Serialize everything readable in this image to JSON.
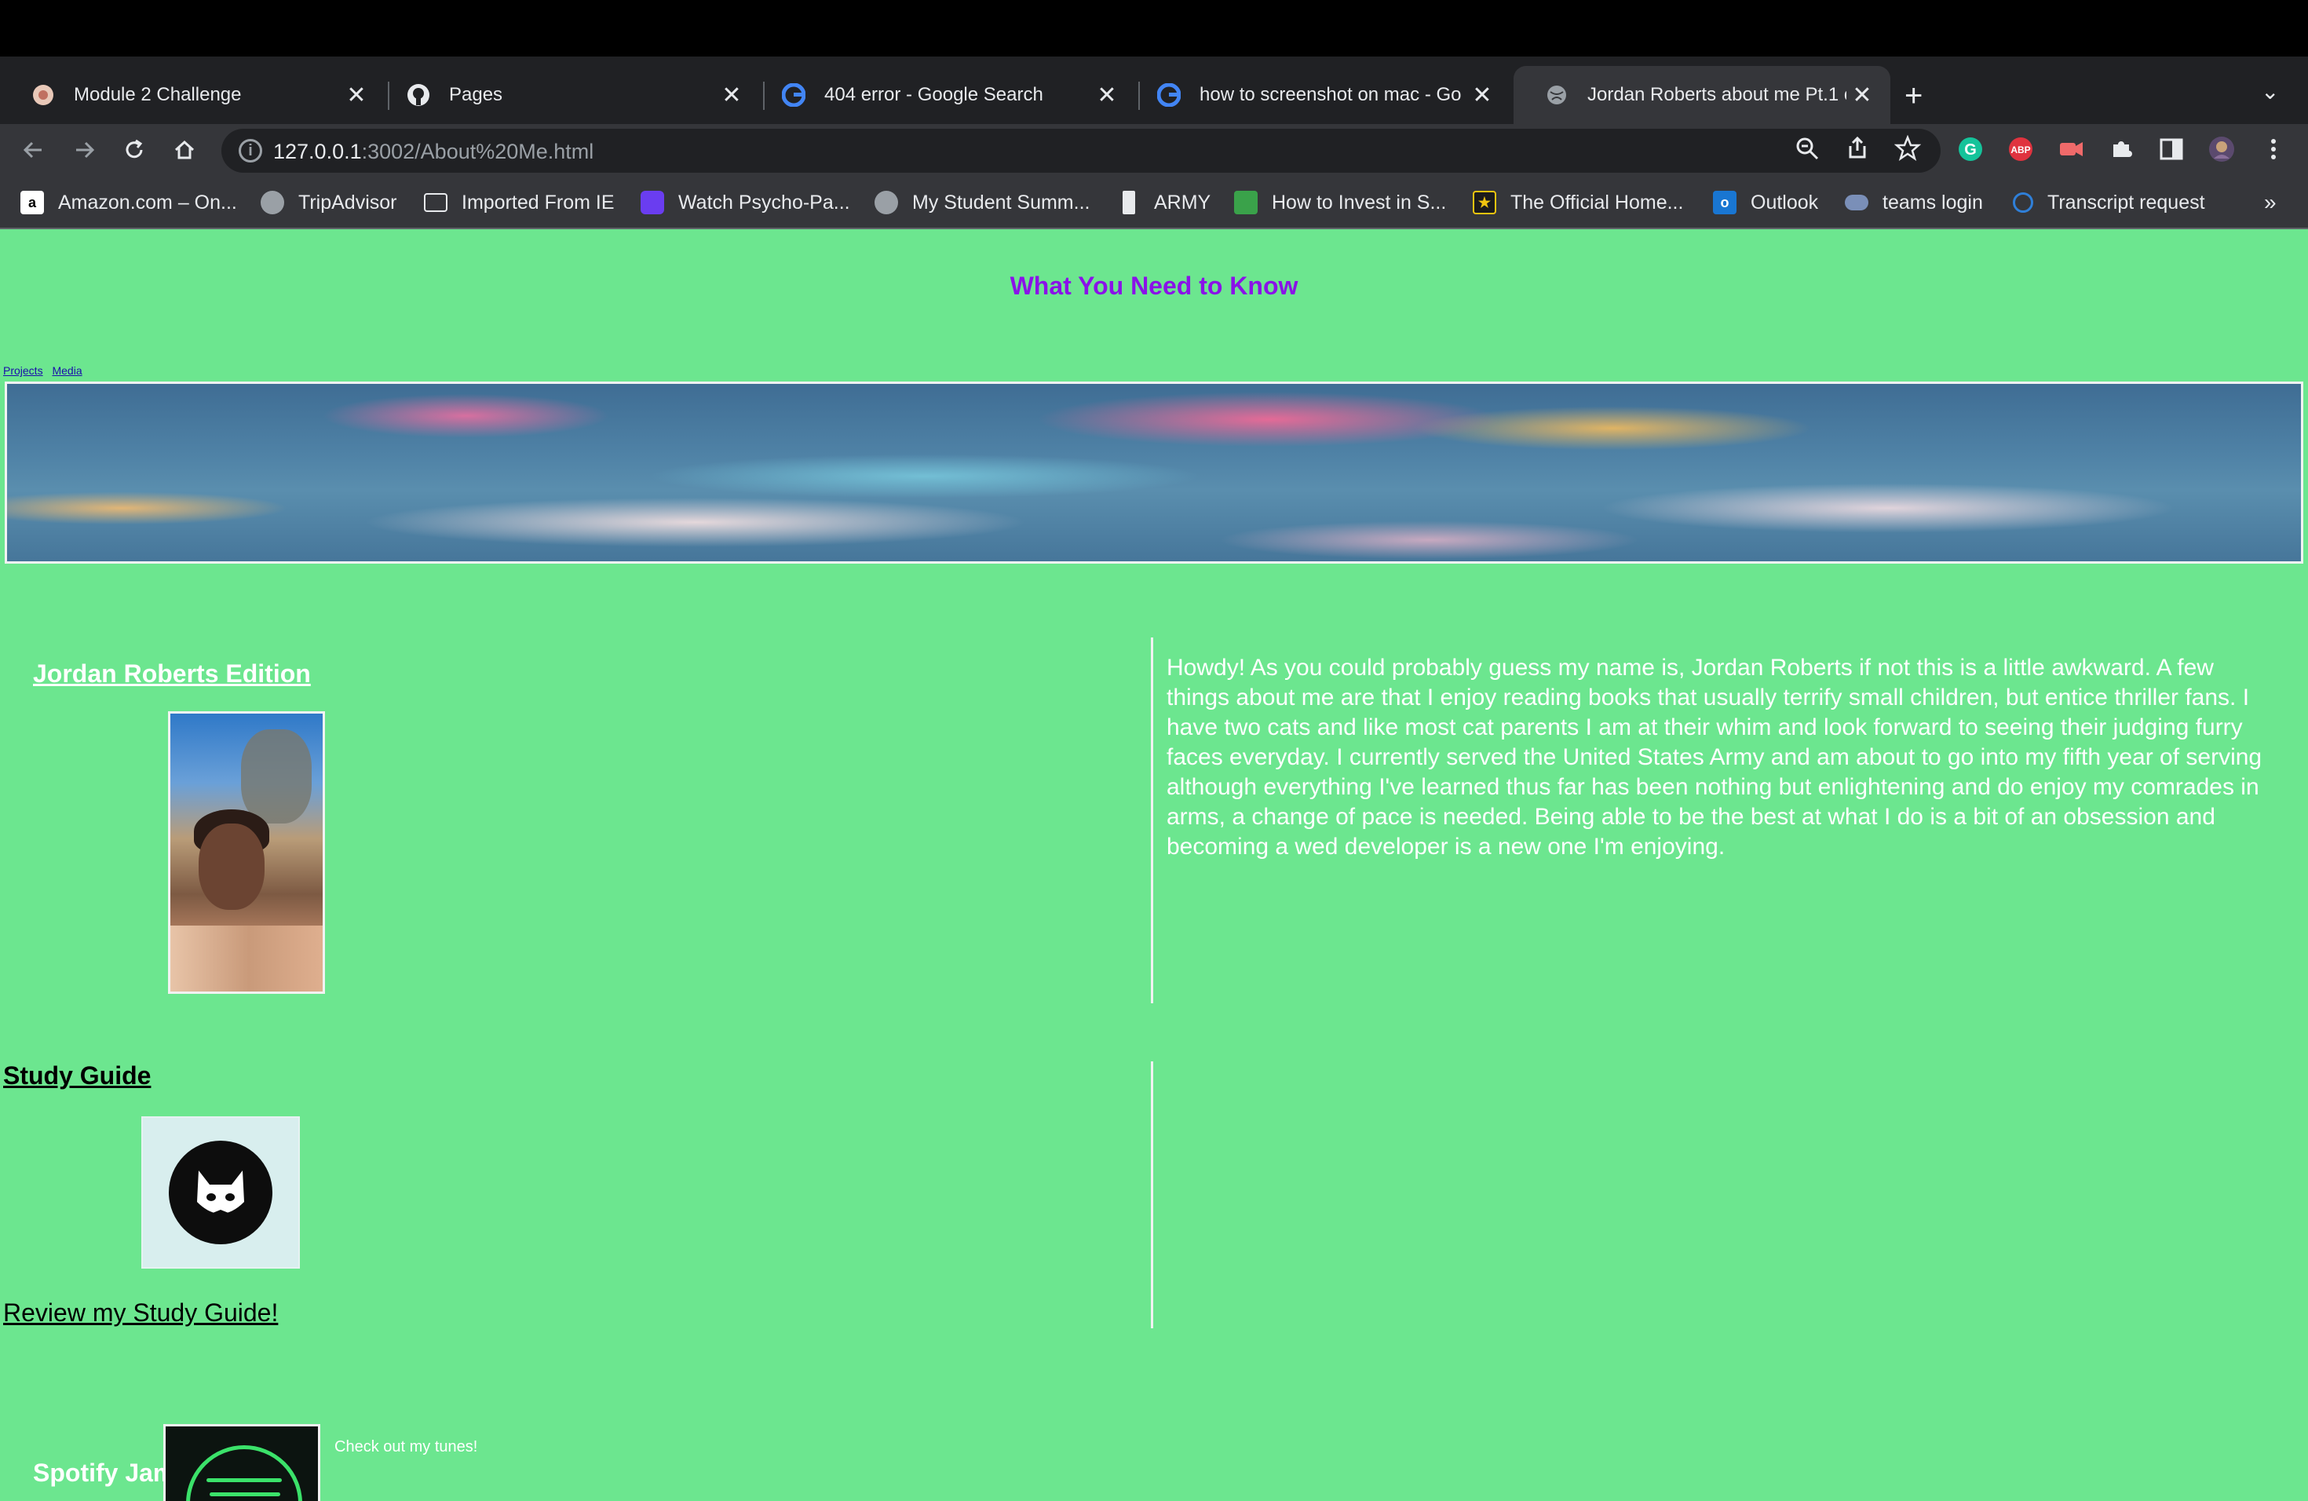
{
  "browser": {
    "tabs": [
      {
        "title": "Module 2 Challenge",
        "favicon": "module-favicon",
        "active": false
      },
      {
        "title": "Pages",
        "favicon": "github-icon",
        "active": false
      },
      {
        "title": "404 error - Google Search",
        "favicon": "google-icon",
        "active": false
      },
      {
        "title": "how to screenshot on mac - Go",
        "favicon": "google-icon",
        "active": false
      },
      {
        "title": "Jordan Roberts about me Pt.1 c",
        "favicon": "globe-icon",
        "active": true
      }
    ],
    "tab_close_glyph": "✕",
    "new_tab_glyph": "+",
    "tab_search_glyph": "⌄",
    "address": {
      "host": "127.0.0.1",
      "path": ":3002/About%20Me.html"
    },
    "bookmarks": [
      {
        "label": "Amazon.com – On...",
        "icon": "amazon-icon"
      },
      {
        "label": "TripAdvisor",
        "icon": "globe-icon"
      },
      {
        "label": "Imported From IE",
        "icon": "folder-icon"
      },
      {
        "label": "Watch Psycho-Pa...",
        "icon": "psycho-pass-icon"
      },
      {
        "label": "My Student Summ...",
        "icon": "globe-icon"
      },
      {
        "label": "ARMY",
        "icon": "army-icon"
      },
      {
        "label": "How to Invest in S...",
        "icon": "invest-icon"
      },
      {
        "label": "The Official Home...",
        "icon": "star-icon"
      },
      {
        "label": "Outlook",
        "icon": "outlook-icon"
      },
      {
        "label": "teams login",
        "icon": "teams-icon"
      },
      {
        "label": "Transcript request",
        "icon": "transcript-icon"
      }
    ],
    "bookmarks_overflow": "»"
  },
  "page": {
    "heading": "What You Need to Know",
    "nav": {
      "projects": "Projects",
      "media": "Media"
    },
    "about": {
      "title": "Jordan Roberts Edition",
      "text": "Howdy! As you could probably guess my name is, Jordan Roberts if not this is a little awkward. A few things about me are that I enjoy reading books that usually terrify small children, but entice thriller fans. I have two cats and like most cat parents I am at their whim and look forward to seeing their judging furry faces everyday. I currently served the United States Army and am about to go into my fifth year of serving although everything I've learned thus far has been nothing but enlightening and do enjoy my comrades in arms, a change of pace is needed. Being able to be the best at what I do is a bit of an obsession and becoming a wed developer is a new one I'm enjoying."
    },
    "study": {
      "title": "Study Guide",
      "link": "Review my Study Guide!"
    },
    "spotify": {
      "title": "Spotify Jams",
      "caption": "Check out my tunes!"
    }
  },
  "colors": {
    "page_bg": "#6ce68f",
    "heading": "#8a12e8",
    "tabstrip": "#202124",
    "toolbar": "#35363a"
  }
}
